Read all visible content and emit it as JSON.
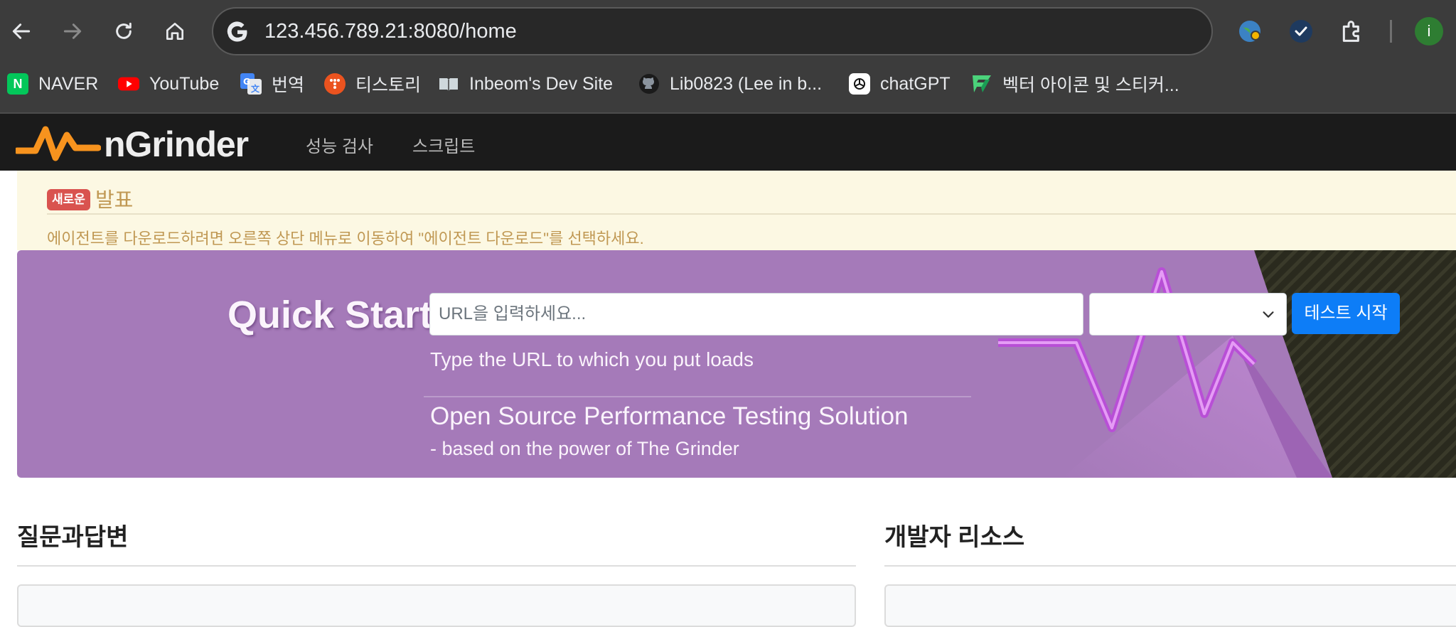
{
  "browser": {
    "url": "123.456.789.21:8080/home",
    "profile_initial": "i",
    "bookmarks": [
      {
        "label": "NAVER",
        "icon": "naver-icon",
        "color": "#03c75a"
      },
      {
        "label": "YouTube",
        "icon": "youtube-icon",
        "color": "#ff0000"
      },
      {
        "label": "번역",
        "icon": "google-translate-icon",
        "color": "#4285f4"
      },
      {
        "label": "티스토리",
        "icon": "tistory-icon",
        "color": "#eb531f"
      },
      {
        "label": "Inbeom's Dev Site",
        "icon": "book-icon",
        "color": "#cfd8dc"
      },
      {
        "label": "Lib0823 (Lee in b...",
        "icon": "github-icon",
        "color": "#1b1b1b"
      },
      {
        "label": "chatGPT",
        "icon": "chatgpt-icon",
        "color": "#ffffff"
      },
      {
        "label": "벡터 아이콘 및 스티커...",
        "icon": "flaticon-icon",
        "color": "#4bd37b"
      }
    ]
  },
  "app": {
    "logo_text": "nGrinder",
    "menu": [
      "성능 검사",
      "스크립트"
    ],
    "notice": {
      "badge": "새로운",
      "title": "발표",
      "message": "에이전트를 다운로드하려면 오른쪽 상단 메뉴로 이동하여 \"에이전트 다운로드\"를 선택하세요."
    },
    "quick_start": {
      "title": "Quick Start",
      "url_placeholder": "URL을 입력하세요...",
      "selected_option": "",
      "start_button": "테스트 시작",
      "hint": "Type the URL to which you put loads",
      "tagline": "Open Source Performance Testing Solution",
      "tagline_sub": "- based on the power of The Grinder"
    },
    "sections": {
      "qna_title": "질문과답변",
      "dev_resources_title": "개발자 리소스"
    },
    "colors": {
      "hero_purple": "#a57ab9",
      "primary_button": "#0d7df7",
      "notice_bg": "#fcf8e3",
      "notice_text": "#c09853",
      "badge_red": "#d9534f"
    }
  }
}
